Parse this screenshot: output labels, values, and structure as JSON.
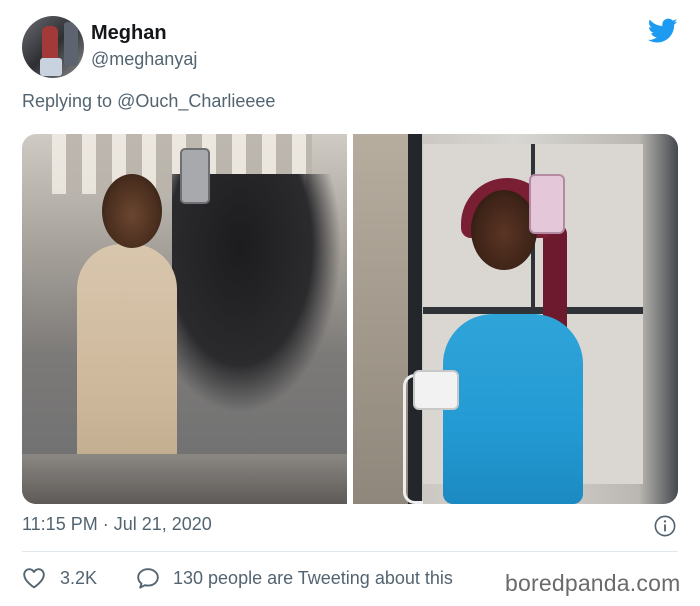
{
  "tweet": {
    "author": {
      "display_name": "Meghan",
      "handle": "@meghanyaj"
    },
    "reply_prefix": "Replying to",
    "reply_to": "@Ouch_Charlieeee",
    "timestamp": "11:15 PM · Jul 21, 2020",
    "likes_count": "3.2K",
    "replies_text": "130 people are Tweeting about this"
  },
  "watermark": "boredpanda.com",
  "colors": {
    "twitter_blue": "#1d9bf0",
    "secondary_text": "#536471"
  },
  "icons": {
    "brand": "twitter-bird-icon",
    "info": "info-icon",
    "like": "heart-icon",
    "reply": "speech-bubble-icon"
  }
}
